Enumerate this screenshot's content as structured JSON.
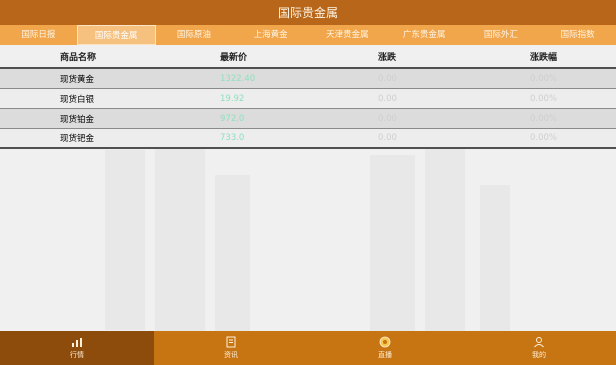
{
  "window": {
    "title": "国际贵金属"
  },
  "tabs": [
    {
      "label": "国际日报"
    },
    {
      "label": "国际贵金属"
    },
    {
      "label": "国际原油"
    },
    {
      "label": "上海黄金"
    },
    {
      "label": "天津贵金属"
    },
    {
      "label": "广东贵金属"
    },
    {
      "label": "国际外汇"
    },
    {
      "label": "国际指数"
    }
  ],
  "table": {
    "headers": {
      "name": "商品名称",
      "latest": "最新价",
      "change": "涨跌",
      "pct": "涨跌幅"
    },
    "rows": [
      {
        "name": "现货黄金",
        "latest": "1322.40",
        "change": "0.00",
        "pct": "0.00%"
      },
      {
        "name": "现货白银",
        "latest": "19.92",
        "change": "0.00",
        "pct": "0.00%"
      },
      {
        "name": "现货铂金",
        "latest": "972.0",
        "change": "0.00",
        "pct": "0.00%"
      },
      {
        "name": "现货钯金",
        "latest": "733.0",
        "change": "0.00",
        "pct": "0.00%"
      }
    ]
  },
  "bottom_nav": [
    {
      "label": "行情",
      "icon": "chart-icon"
    },
    {
      "label": "资讯",
      "icon": "document-icon"
    },
    {
      "label": "直播",
      "icon": "coin-icon"
    },
    {
      "label": "我的",
      "icon": "user-icon"
    }
  ],
  "colors": {
    "title_bg": "#b8671a",
    "tab_bg": "#f1a64c",
    "bottom_bg": "#c77413",
    "bottom_active": "#8e4c0c",
    "price": "#8fe0c0"
  }
}
